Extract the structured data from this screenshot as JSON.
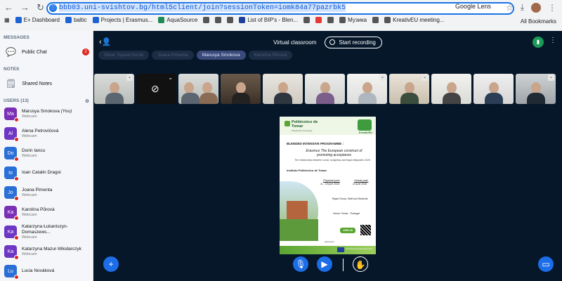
{
  "browser": {
    "url_host": "bbb03.uni-svishtov.bg/html5client/join?sessionToken=iomk84a77pazrbk5",
    "google_lens": "Google Lens",
    "bookmarks": [
      "E+ Dashboard",
      "baltic",
      "Projects | Erasmus...",
      "AquaSource",
      "List of BIP's - Blen...",
      "Музика",
      "KreativEU meeting..."
    ],
    "all_bookmarks": "All Bookmarks"
  },
  "sidebar": {
    "messages_header": "MESSAGES",
    "public_chat": "Public Chat",
    "public_chat_badge": "2",
    "notes_header": "NOTES",
    "shared_notes": "Shared Notes",
    "users_header": "USERS (13)",
    "users": [
      {
        "initials": "Ma",
        "name": "Marusya Smokova",
        "you": "(You)",
        "sub": "Webcam",
        "color": "#7b2fb5"
      },
      {
        "initials": "Al",
        "name": "Alena Petrovičová",
        "sub": "Webcam",
        "color": "#6d36c4"
      },
      {
        "initials": "Do",
        "name": "Dorin Iancu",
        "sub": "Webcam",
        "color": "#2a6fd6"
      },
      {
        "initials": "Io",
        "name": "Ioan Catalin Dragoi",
        "sub": "",
        "color": "#2a6fd6"
      },
      {
        "initials": "Jo",
        "name": "Joana Pimenta",
        "sub": "Webcam",
        "color": "#2a6fd6"
      },
      {
        "initials": "Ka",
        "name": "Karolína Půrová",
        "sub": "Webcam",
        "color": "#7b2fb5"
      },
      {
        "initials": "Ka",
        "name": "Katarzyna Łukaniszyn-Domaszews...",
        "sub": "Webcam",
        "color": "#6d36c4"
      },
      {
        "initials": "Ka",
        "name": "Katarzyna Mazur-Włodarczyk",
        "sub": "Webcam",
        "color": "#6d36c4"
      },
      {
        "initials": "Lu",
        "name": "Lucia Nováková",
        "sub": "",
        "color": "#2a6fd6"
      }
    ]
  },
  "main": {
    "title": "Virtual classroom",
    "record_label": "Start recording",
    "chips": [
      "Omer Tupsal Doruk",
      "Joana Pimenta",
      "Marusya Smokova",
      "Karolína Půrová"
    ],
    "poster": {
      "org": "Politécnico de Tomar",
      "org_sub": "Polytechnic University",
      "brand": "KreativEU",
      "heading": "BLENDED INTENSIVE PROGRAMME :",
      "subtitle": "Erasmus The European construct of promoting acceptance",
      "desc": "The relationship between social, budgetary and legal integration 2026",
      "institute": "Instituto Politécnico de Tomar",
      "physical_label": "Physical part:",
      "physical_dates": "11 - 15 june 2026",
      "virtual_label": "Virtual part:",
      "virtual_dates": "24 june 2026",
      "target": "Target Group: Staff and Students",
      "venue": "Venue: Tomar - Portugal",
      "join": "JOIN US",
      "site": "www.ipt.pt",
      "eu": "Co-funded by the European Union"
    }
  }
}
